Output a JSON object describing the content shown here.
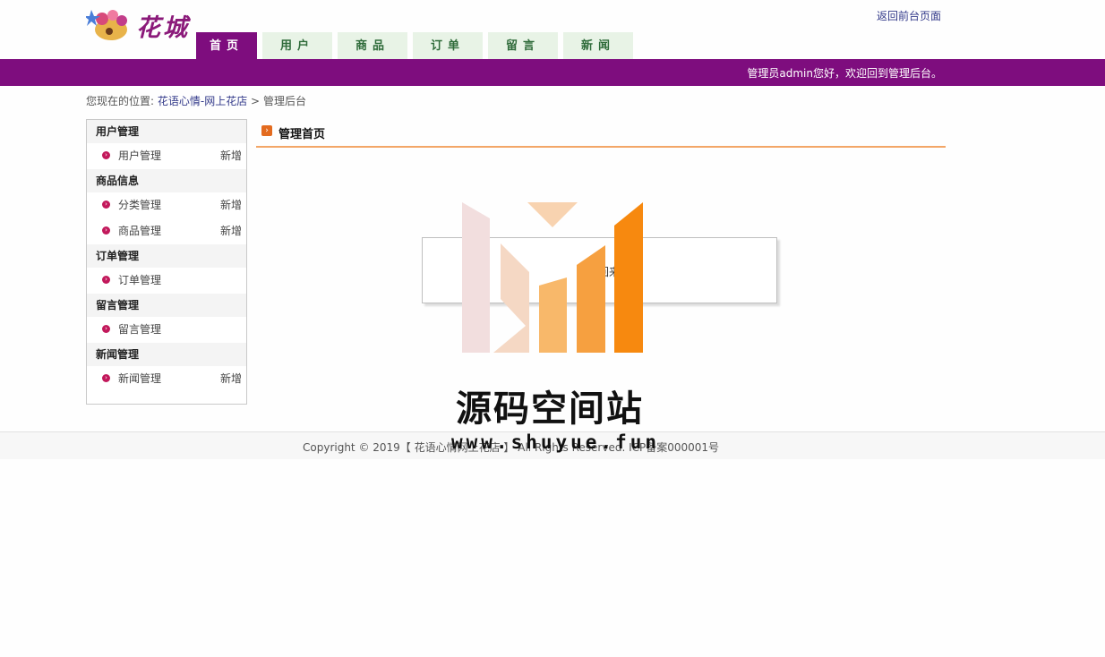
{
  "header": {
    "logo_text": "花城",
    "back_link": "返回前台页面",
    "tabs": [
      {
        "label": "首页"
      },
      {
        "label": "用户"
      },
      {
        "label": "商品"
      },
      {
        "label": "订单"
      },
      {
        "label": "留言"
      },
      {
        "label": "新闻"
      }
    ],
    "welcome": "管理员admin您好，欢迎回到管理后台。"
  },
  "breadcrumb": {
    "prefix": "您现在的位置:",
    "site": "花语心情-网上花店",
    "sep": ">",
    "current": "管理后台"
  },
  "sidebar": {
    "sections": [
      {
        "title": "用户管理",
        "items": [
          {
            "label": "用户管理",
            "add": "新增"
          }
        ]
      },
      {
        "title": "商品信息",
        "items": [
          {
            "label": "分类管理",
            "add": "新增"
          },
          {
            "label": "商品管理",
            "add": "新增"
          }
        ]
      },
      {
        "title": "订单管理",
        "items": [
          {
            "label": "订单管理",
            "add": ""
          }
        ]
      },
      {
        "title": "留言管理",
        "items": [
          {
            "label": "留言管理",
            "add": ""
          }
        ]
      },
      {
        "title": "新闻管理",
        "items": [
          {
            "label": "新闻管理",
            "add": "新增"
          }
        ]
      }
    ]
  },
  "main": {
    "title": "管理首页",
    "message": "欢迎回来"
  },
  "watermark": {
    "title": "源码空间站",
    "url": "www.shuyue.fun"
  },
  "footer": {
    "copyright": "Copyright © 2019【 花语心情网上花店 】 All Rights Reserved. ICP备案000001号"
  },
  "colors": {
    "brand_purple": "#7e0d7e",
    "tab_green_bg": "#e8f3e6",
    "accent_orange": "#f3a667"
  }
}
